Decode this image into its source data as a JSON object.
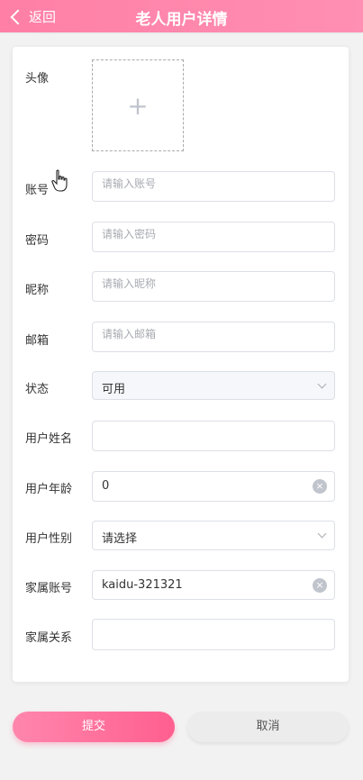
{
  "header": {
    "back_label": "返回",
    "title": "老人用户详情"
  },
  "form": {
    "avatar_label": "头像",
    "avatar_plus": "+",
    "account_label": "账号",
    "account_placeholder": "请输入账号",
    "password_label": "密码",
    "password_placeholder": "请输入密码",
    "nickname_label": "昵称",
    "nickname_placeholder": "请输入昵称",
    "email_label": "邮箱",
    "email_placeholder": "请输入邮箱",
    "status_label": "状态",
    "status_value": "可用",
    "name_label": "用户姓名",
    "name_value": "",
    "age_label": "用户年龄",
    "age_value": "0",
    "gender_label": "用户性别",
    "gender_value": "请选择",
    "family_account_label": "家属账号",
    "family_account_value": "kaidu-321321",
    "relation_label": "家属关系",
    "relation_value": "",
    "clear_icon": "×"
  },
  "buttons": {
    "submit": "提交",
    "cancel": "取消"
  },
  "colors": {
    "accent": "#ff7fa6",
    "accent_dark": "#ff5f8f"
  }
}
